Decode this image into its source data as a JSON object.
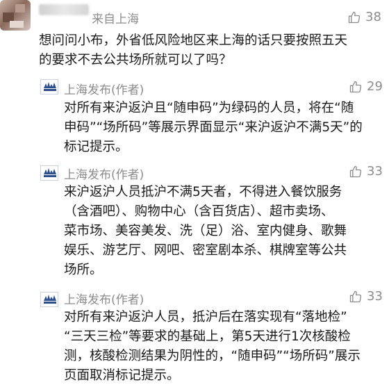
{
  "comments": [
    {
      "author": "来自上海",
      "likes": "38",
      "lines": [
        "想问问小布，外省低风险地区来上海的话只要按照五天",
        "的要求不去公共场所就可以了吗？"
      ]
    }
  ],
  "replies": [
    {
      "author": "上海发布(作者)",
      "likes": "29",
      "lines": [
        "对所有来沪返沪且“随申码”为绿码的人员，将在“随",
        "申码”“场所码”等展示界面显示“来沪返沪不满5天”的",
        "标记提示。"
      ]
    },
    {
      "author": "上海发布(作者)",
      "likes": "33",
      "lines": [
        "来沪返沪人员抵沪不满5天者，不得进入餐饮服务",
        "（含酒吧）、购物中心（含百货店）、超市卖场、",
        "菜市场、美容美发、洗（足）浴、室内健身、歌舞",
        "娱乐、游艺厅、网吧、密室剧本杀、棋牌室等公共",
        "场所。"
      ]
    },
    {
      "author": "上海发布(作者)",
      "likes": "33",
      "lines": [
        "对所有来沪返沪人员，抵沪后在落实现有“落地检”",
        "“三天三检”等要求的基础上，第5天进行1次核酸检",
        "测，核酸检测结果为阴性的，“随申码”“场所码”展示",
        "页面取消标记提示。"
      ]
    }
  ],
  "icons": {
    "like": "thumbs-up-icon",
    "logo": "shanghai-fabu-logo"
  },
  "colors": {
    "meta": "#8c8c8c",
    "text": "#1a1a1a",
    "logo": "#2b4d8c"
  }
}
